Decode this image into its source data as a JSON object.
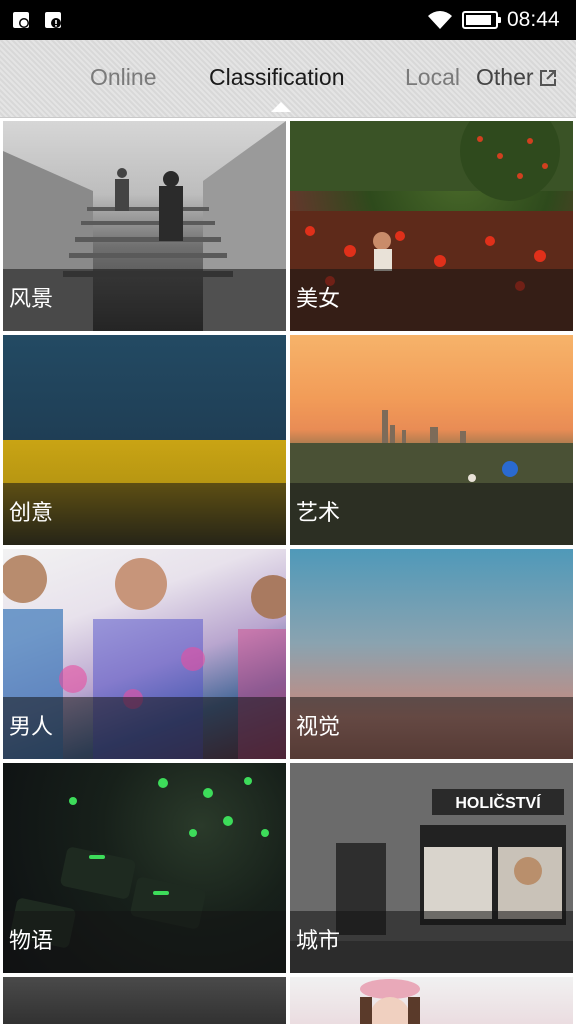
{
  "status_bar": {
    "time": "08:44",
    "battery_level": 0.9,
    "icons": [
      "notification-icon",
      "notification-icon",
      "wifi-icon",
      "battery-icon"
    ]
  },
  "tabs": [
    {
      "label": "Online",
      "selected": false
    },
    {
      "label": "Classification",
      "selected": true
    },
    {
      "label": "Local",
      "selected": false
    },
    {
      "label": "Other",
      "selected": false,
      "icon": "share-out-icon"
    }
  ],
  "categories": [
    {
      "label": "风景"
    },
    {
      "label": "美女"
    },
    {
      "label": "创意"
    },
    {
      "label": "艺术"
    },
    {
      "label": "男人"
    },
    {
      "label": "视觉"
    },
    {
      "label": "物语"
    },
    {
      "label": "城市"
    },
    {
      "label": ""
    },
    {
      "label": ""
    }
  ],
  "colors": {
    "status_bar_bg": "#000000",
    "tab_selected": "#1a1a1a",
    "tab_unselected": "#7a7a7a",
    "caption_overlay": "rgba(20,20,20,0.55)"
  },
  "city_tile_sign": "HOLIČSTVÍ"
}
